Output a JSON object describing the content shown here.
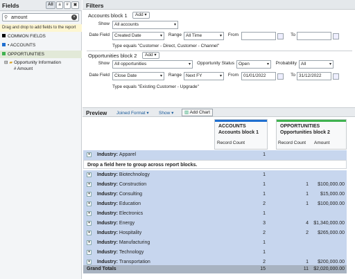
{
  "fields_panel": {
    "title": "Fields",
    "filter_buttons": [
      "All",
      "a",
      "#",
      "▣"
    ],
    "search": {
      "value": "amount",
      "placeholder": "Quick Find"
    },
    "hint": "Drag and drop to add fields to the report",
    "groups": [
      {
        "label": "COMMON FIELDS",
        "color": "#000000"
      },
      {
        "label": "• ACCOUNTS",
        "color": "#1f6fd0"
      },
      {
        "label": "OPPORTUNITIES",
        "color": "#3fb24f"
      }
    ],
    "tree_folder": "Opportunity Information",
    "tree_field": "Amount"
  },
  "filters": {
    "title": "Filters",
    "block1": {
      "name": "Accounts block 1",
      "add_label": "Add",
      "show_label": "Show",
      "show_value": "All accounts",
      "date_field_label": "Date Field",
      "date_field_value": "Created Date",
      "range_label": "Range",
      "range_value": "All Time",
      "from_label": "From",
      "from_value": "",
      "to_label": "To",
      "to_value": "",
      "type_filter": "Type equals \"Customer - Direct, Customer - Channel\""
    },
    "block2": {
      "name": "Opportunities block 2",
      "add_label": "Add",
      "show_label": "Show",
      "show_value": "All opportunities",
      "status_label": "Opportunity Status",
      "status_value": "Open",
      "prob_label": "Probability",
      "prob_value": "All",
      "date_field_label": "Date Field",
      "date_field_value": "Close Date",
      "range_label": "Range",
      "range_value": "Next FY",
      "from_label": "From",
      "from_value": "01/01/2022",
      "to_label": "To",
      "to_value": "31/12/2022",
      "type_filter": "Type equals \"Existing Customer - Upgrade\""
    }
  },
  "preview": {
    "title": "Preview",
    "format": "Joined Format",
    "show": "Show",
    "add_chart": "Add Chart",
    "block_a": {
      "title": "ACCOUNTS",
      "name": "Accounts block 1",
      "col": "Record Count",
      "color": "#1f6fd0"
    },
    "block_b": {
      "title": "OPPORTUNITIES",
      "name": "Opportunities block 2",
      "col1": "Record Count",
      "col2": "Amount",
      "color": "#3fb24f"
    },
    "industry_label": "Industry:",
    "first_row": {
      "industry": "Apparel",
      "acc": "1",
      "opp": "",
      "amount": ""
    },
    "drop_text": "Drop a field here to group across report blocks.",
    "rows": [
      {
        "industry": "Biotechnology",
        "acc": "1",
        "opp": "",
        "amount": ""
      },
      {
        "industry": "Construction",
        "acc": "1",
        "opp": "1",
        "amount": "$100,000.00"
      },
      {
        "industry": "Consulting",
        "acc": "1",
        "opp": "1",
        "amount": "$15,000.00"
      },
      {
        "industry": "Education",
        "acc": "2",
        "opp": "1",
        "amount": "$100,000.00"
      },
      {
        "industry": "Electronics",
        "acc": "1",
        "opp": "",
        "amount": ""
      },
      {
        "industry": "Energy",
        "acc": "3",
        "opp": "4",
        "amount": "$1,340,000.00"
      },
      {
        "industry": "Hospitality",
        "acc": "2",
        "opp": "2",
        "amount": "$265,000.00"
      },
      {
        "industry": "Manufacturing",
        "acc": "1",
        "opp": "",
        "amount": ""
      },
      {
        "industry": "Technology",
        "acc": "1",
        "opp": "",
        "amount": ""
      },
      {
        "industry": "Transportation",
        "acc": "2",
        "opp": "1",
        "amount": "$200,000.00"
      }
    ],
    "grand_totals": {
      "label": "Grand Totals",
      "acc": "15",
      "opp": "11",
      "amount": "$2,020,000.00"
    }
  }
}
